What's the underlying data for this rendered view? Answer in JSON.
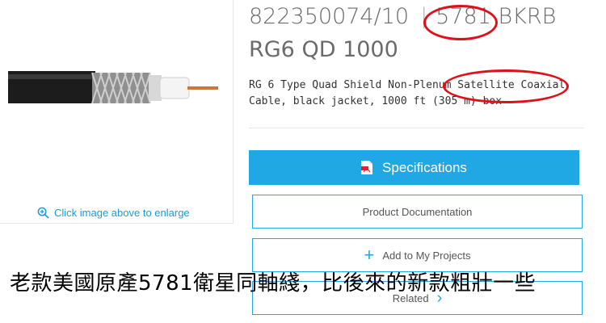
{
  "left": {
    "image_alt": "RG6 coaxial cable with quad shield, black jacket",
    "enlarge_hint": "Click image above to enlarge"
  },
  "product": {
    "part_number": "822350074/10",
    "separator": "|",
    "model_code": "5781 BKRB",
    "name": "RG6 QD 1000",
    "description": "RG 6 Type Quad Shield Non-Plenum Satellite Coaxial Cable, black jacket, 1000 ft (305 m) box"
  },
  "actions": {
    "specifications": "Specifications",
    "product_documentation": "Product Documentation",
    "add_to_projects": "Add to My Projects",
    "related": "Related"
  },
  "overlay": {
    "caption": "老款美國原產5781衛星同軸綫，比後來的新款粗壯一些"
  },
  "colors": {
    "accent": "#1fa8e4",
    "annotation": "#e0101a"
  }
}
